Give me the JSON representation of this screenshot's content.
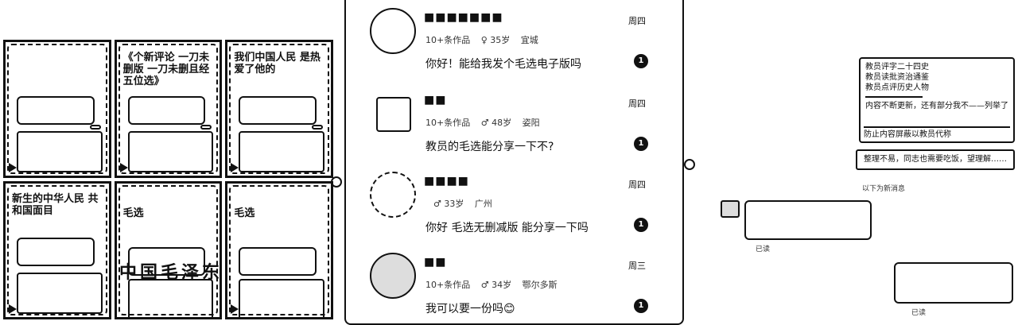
{
  "left": {
    "tiles": [
      {
        "headline": ""
      },
      {
        "headline": "《个新评论 一刀未删版 一刀未删且经五位选》"
      },
      {
        "headline": "我们中国人民 是热爱了他的"
      },
      {
        "headline": "新生的中华人民 共和国面目"
      },
      {
        "headline": "毛选"
      },
      {
        "headline": "毛选"
      }
    ],
    "overlay_text": "中国毛泽东"
  },
  "messages": [
    {
      "name": "■■■■■■■",
      "works": "10+条作品",
      "age": "♀ 35岁",
      "city": "宜城",
      "time": "周四",
      "text": "你好！能给我发个毛选电子版吗",
      "badge": "1"
    },
    {
      "name": "■■",
      "works": "10+条作品",
      "age": "♂ 48岁",
      "city": "姿阳",
      "time": "周四",
      "text": "教员的毛选能分享一下不?",
      "badge": "1"
    },
    {
      "name": "■■■■",
      "works": "",
      "age": "♂ 33岁",
      "city": "广州",
      "time": "周四",
      "text": "你好 毛选无删减版 能分享一下吗",
      "badge": "1"
    },
    {
      "name": "■■",
      "works": "10+条作品",
      "age": "♂ 34岁",
      "city": "鄂尔多斯",
      "time": "周三",
      "text": "我可以要一份吗😊",
      "badge": "1"
    }
  ],
  "right": {
    "card_lines": [
      "教员评字二十四史",
      "教员读批资治通鉴",
      "教员点评历史人物"
    ],
    "card_note": "内容不断更新，还有部分我不——列举了",
    "card_sub": "防止内容屏蔽以教员代称",
    "warning": "整理不易，同志也需要吃饭，望理解……",
    "small_label": "以下为新消息",
    "read1": "已读",
    "read2": "已读"
  }
}
